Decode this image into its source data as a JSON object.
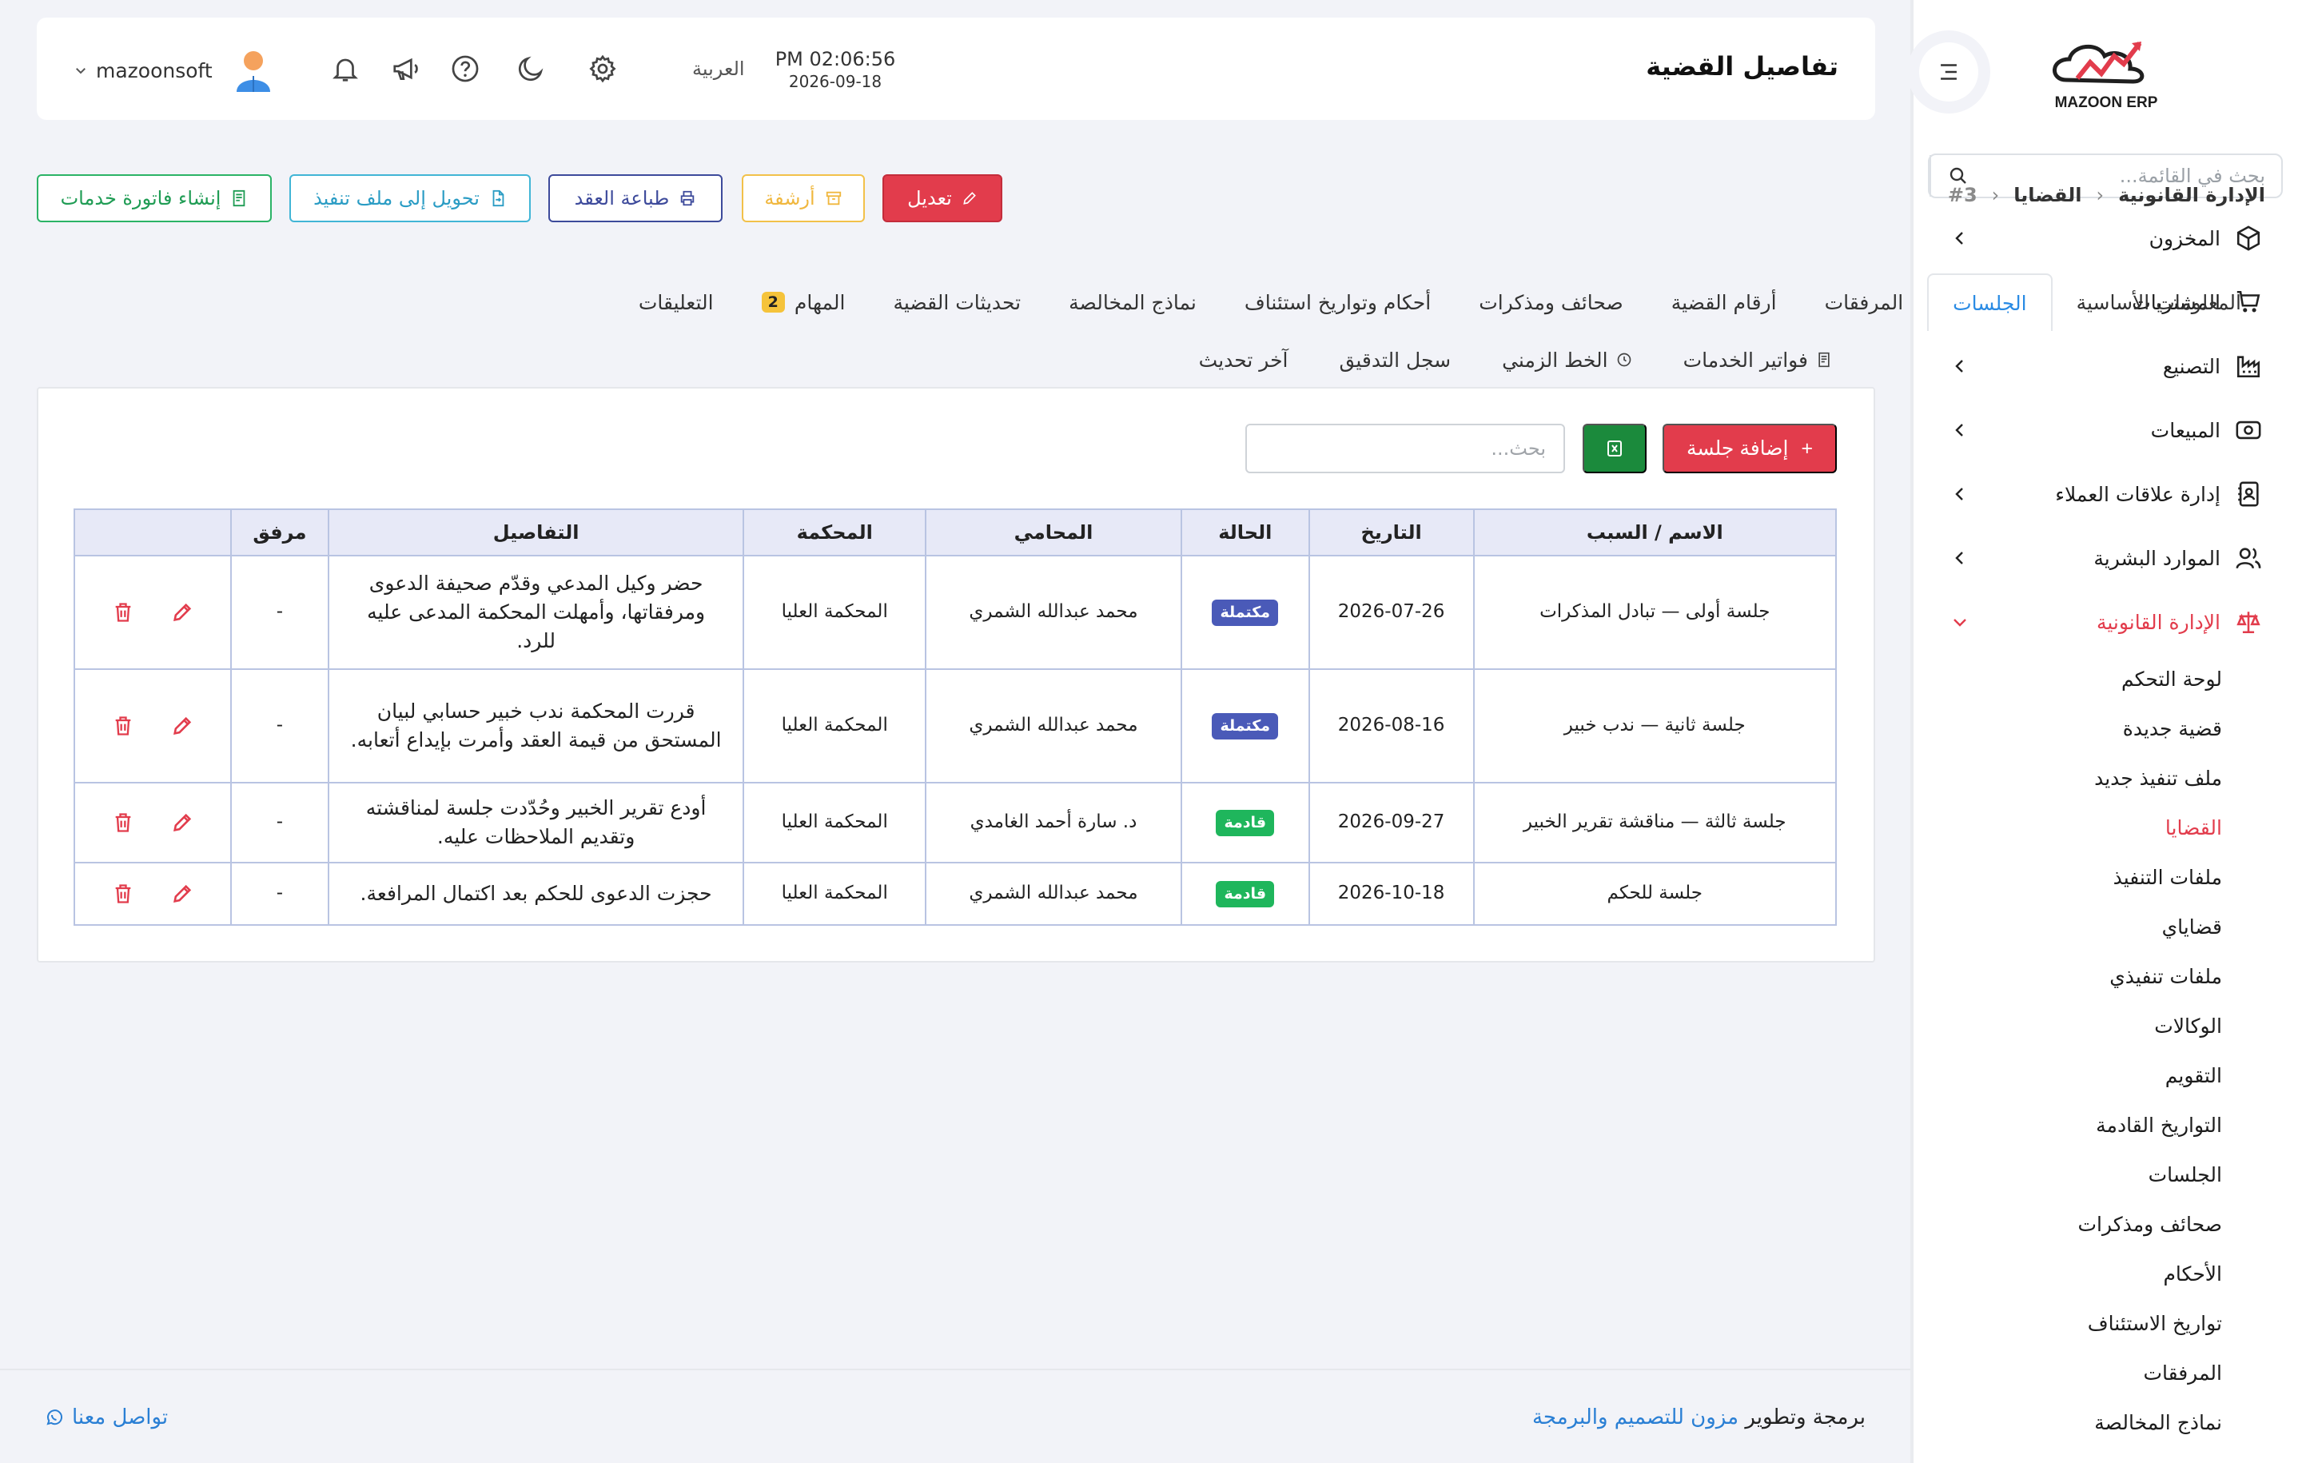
{
  "brand": {
    "name": "MAZOON ERP",
    "tagline": "ERP"
  },
  "sidebar": {
    "search_placeholder": "بحث في القائمة...",
    "items": [
      {
        "label": "المخزون",
        "icon": "box-icon"
      },
      {
        "label": "المشتريات",
        "icon": "cart-icon"
      },
      {
        "label": "التصنيع",
        "icon": "factory-icon"
      },
      {
        "label": "المبيعات",
        "icon": "cash-icon"
      },
      {
        "label": "إدارة علاقات العملاء",
        "icon": "contacts-icon"
      },
      {
        "label": "الموارد البشرية",
        "icon": "users-icon"
      },
      {
        "label": "الإدارة القانونية",
        "icon": "scale-icon",
        "active": true
      }
    ],
    "subitems": [
      "لوحة التحكم",
      "قضية جديدة",
      "ملف تنفيذ جديد",
      "القضايا",
      "ملفات التنفيذ",
      "قضاياي",
      "ملفات تنفيذي",
      "الوكالات",
      "التقويم",
      "التواريخ القادمة",
      "الجلسات",
      "صحائف ومذكرات",
      "الأحكام",
      "تواريخ الاستئناف",
      "المرفقات",
      "نماذج المخالصة"
    ],
    "active_subitem": "القضايا"
  },
  "header": {
    "title": "تفاصيل القضية",
    "time": "PM 02:06:56",
    "date": "2026-09-18",
    "language": "العربية",
    "username": "mazoonsoft"
  },
  "breadcrumb": {
    "root": "الإدارة القانونية",
    "section": "القضايا",
    "current": "#3"
  },
  "actions": {
    "edit": "تعديل",
    "archive": "أرشفة",
    "print": "طباعة العقد",
    "transfer": "تحويل إلى ملف تنفيذ",
    "invoice": "إنشاء فاتورة خدمات"
  },
  "tabs": [
    {
      "label": "المعلومات الأساسية"
    },
    {
      "label": "الجلسات",
      "active": true
    },
    {
      "label": "المرفقات"
    },
    {
      "label": "أرقام القضية"
    },
    {
      "label": "صحائف ومذكرات"
    },
    {
      "label": "أحكام وتواريخ استئناف"
    },
    {
      "label": "نماذج المخالصة"
    },
    {
      "label": "تحديثات القضية"
    },
    {
      "label": "المهام",
      "badge": "2"
    },
    {
      "label": "التعليقات"
    }
  ],
  "tabs2": [
    {
      "label": "فواتير الخدمات"
    },
    {
      "label": "الخط الزمني"
    },
    {
      "label": "سجل التدقيق"
    },
    {
      "label": "آخر تحديث"
    }
  ],
  "sessions": {
    "add_label": "إضافة جلسة",
    "search_placeholder": "بحث...",
    "columns": [
      "الاسم / السبب",
      "التاريخ",
      "الحالة",
      "المحامي",
      "المحكمة",
      "التفاصيل",
      "مرفق",
      ""
    ],
    "rows": [
      {
        "name": "جلسة أولى — تبادل المذكرات",
        "date": "2026-07-26",
        "status": "مكتملة",
        "status_color": "#4a5ab8",
        "lawyer": "محمد عبدالله الشمري",
        "court": "المحكمة العليا",
        "details": "حضر وكيل المدعي وقدّم صحيفة الدعوى ومرفقاتها، وأمهلت المحكمة المدعى عليه للرد.",
        "attachment": "-"
      },
      {
        "name": "جلسة ثانية — ندب خبير",
        "date": "2026-08-16",
        "status": "مكتملة",
        "status_color": "#4a5ab8",
        "lawyer": "محمد عبدالله الشمري",
        "court": "المحكمة العليا",
        "details": "قررت المحكمة ندب خبير حسابي لبيان المستحق من قيمة العقد وأمرت بإيداع أتعابه.",
        "attachment": "-"
      },
      {
        "name": "جلسة ثالثة — مناقشة تقرير الخبير",
        "date": "2026-09-27",
        "status": "قادمة",
        "status_color": "#1fb65c",
        "lawyer": "د. سارة أحمد الغامدي",
        "court": "المحكمة العليا",
        "details": "أودع تقرير الخبير وحُدّدت جلسة لمناقشته وتقديم الملاحظات عليه.",
        "attachment": "-"
      },
      {
        "name": "جلسة للحكم",
        "date": "2026-10-18",
        "status": "قادمة",
        "status_color": "#1fb65c",
        "lawyer": "محمد عبدالله الشمري",
        "court": "المحكمة العليا",
        "details": "حجزت الدعوى للحكم بعد اكتمال المرافعة.",
        "attachment": "-"
      }
    ]
  },
  "footer": {
    "credit_prefix": "برمجة وتطوير",
    "credit_link": "مزون للتصميم والبرمجة",
    "contact": "تواصل معنا"
  },
  "colors": {
    "accent": "#e23c4c",
    "link": "#2a8be4",
    "header_row": "#e7e9f7",
    "completed": "#4a5ab8",
    "upcoming": "#1fb65c"
  }
}
